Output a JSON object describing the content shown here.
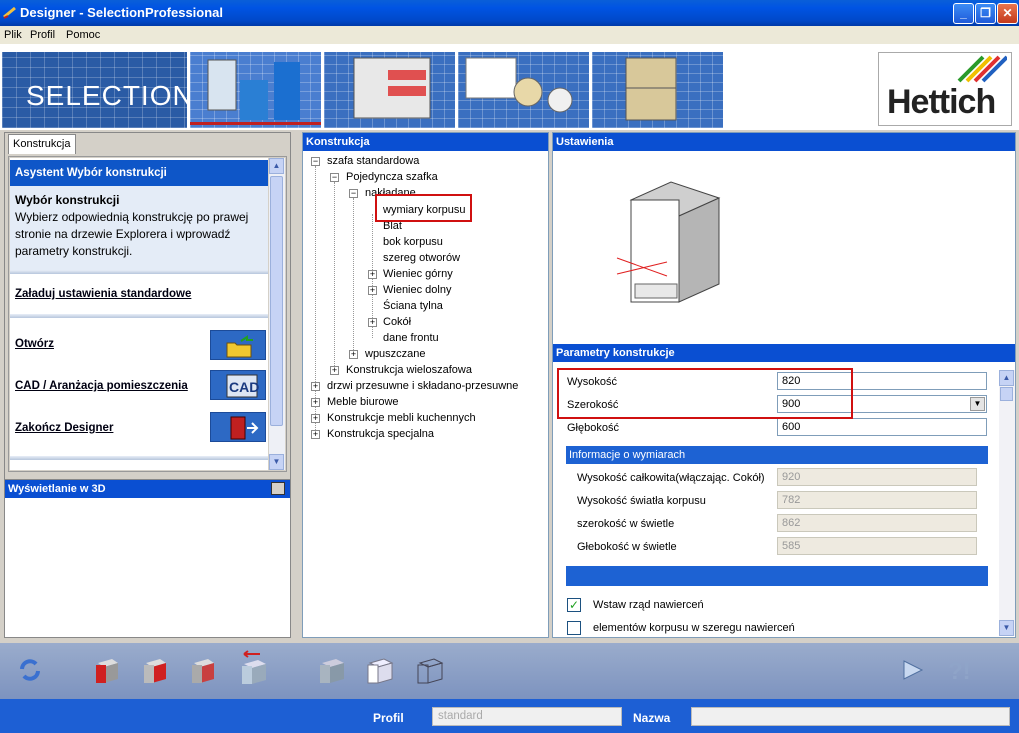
{
  "window": {
    "title": "Designer - SelectionProfessional"
  },
  "menu": [
    "Plik",
    "Profil",
    "Pomoc"
  ],
  "banner": {
    "logo_text": "SELECTION",
    "brand": "Hettich"
  },
  "left": {
    "tab": "Konstrukcja",
    "assistant_title": "Asystent Wybór konstrukcji",
    "desc_title": "Wybór konstrukcji",
    "desc_text": "Wybierz odpowiednią konstrukcję po prawej stronie na drzewie Explorera i wprowadź parametry konstrukcji.",
    "links": [
      "Załaduj ustawienia standardowe",
      "Otwórz",
      "CAD / Aranżacja pomieszczenia",
      "Zakończ Designer"
    ],
    "cad_icon_text": "CAD",
    "view3d_title": "Wyświetlanie w 3D"
  },
  "tree": {
    "title": "Konstrukcja",
    "nodes": [
      "szafa standardowa",
      "Pojedyncza szafka",
      "nakładane",
      "wymiary korpusu",
      "Blat",
      "bok korpusu",
      "szereg otworów",
      "Wieniec górny",
      "Wieniec dolny",
      "Ściana tylna",
      "Cokół",
      "dane frontu",
      "wpuszczane",
      "Konstrukcja wieloszafowa",
      "drzwi przesuwne i składano-przesuwne",
      "Meble biurowe",
      "Konstrukcje mebli kuchennych",
      "Konstrukcja specjalna"
    ]
  },
  "right": {
    "title": "Ustawienia",
    "params_title": "Parametry konstrukcje",
    "params": [
      {
        "label": "Wysokość",
        "value": "820"
      },
      {
        "label": "Szerokość",
        "value": "900"
      },
      {
        "label": "Głębokość",
        "value": "600"
      }
    ],
    "info_title": "Informacje o wymiarach",
    "info": [
      {
        "label": "Wysokość całkowita(włączając. Cokół)",
        "value": "920"
      },
      {
        "label": "Wysokość światła korpusu",
        "value": "782"
      },
      {
        "label": "szerokość w świetle",
        "value": "862"
      },
      {
        "label": "Głebokość w świetle",
        "value": "585"
      }
    ],
    "checks": [
      {
        "label": "Wstaw rząd nawierceń",
        "checked": "✓"
      },
      {
        "label": "elementów korpusu w szeregu nawierceń",
        "checked": ""
      }
    ]
  },
  "status": {
    "profil_label": "Profil",
    "profil_value": "standard",
    "nazwa_label": "Nazwa",
    "nazwa_value": ""
  }
}
